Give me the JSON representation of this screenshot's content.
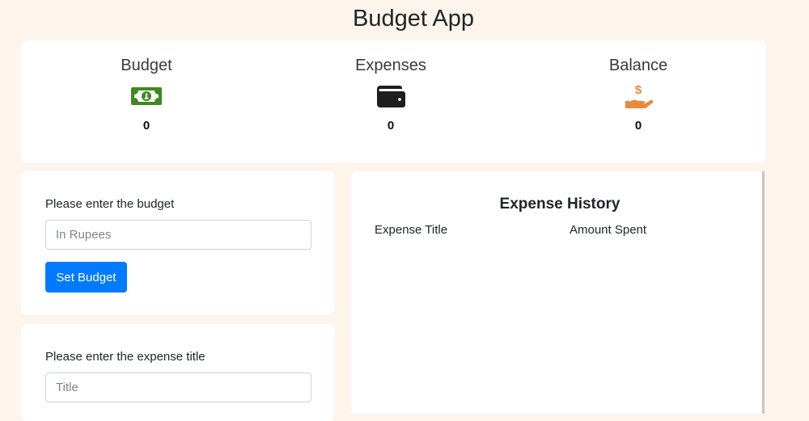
{
  "app": {
    "title": "Budget App"
  },
  "summary": {
    "budget": {
      "label": "Budget",
      "value": "0",
      "icon": "money-bill-icon",
      "color": "#3d8b1f"
    },
    "expenses": {
      "label": "Expenses",
      "value": "0",
      "icon": "wallet-icon",
      "color": "#1e1e1e"
    },
    "balance": {
      "label": "Balance",
      "value": "0",
      "icon": "hand-holding-dollar-icon",
      "color": "#e8893c"
    }
  },
  "budget_form": {
    "label": "Please enter the budget",
    "placeholder": "In Rupees",
    "value": "",
    "button_label": "Set Budget"
  },
  "expense_form": {
    "label": "Please enter the expense title",
    "placeholder": "Title",
    "value": ""
  },
  "history": {
    "title": "Expense History",
    "columns": [
      "Expense Title",
      "Amount Spent"
    ],
    "rows": []
  },
  "colors": {
    "background": "#fdf4ec",
    "primary": "#007bff"
  }
}
